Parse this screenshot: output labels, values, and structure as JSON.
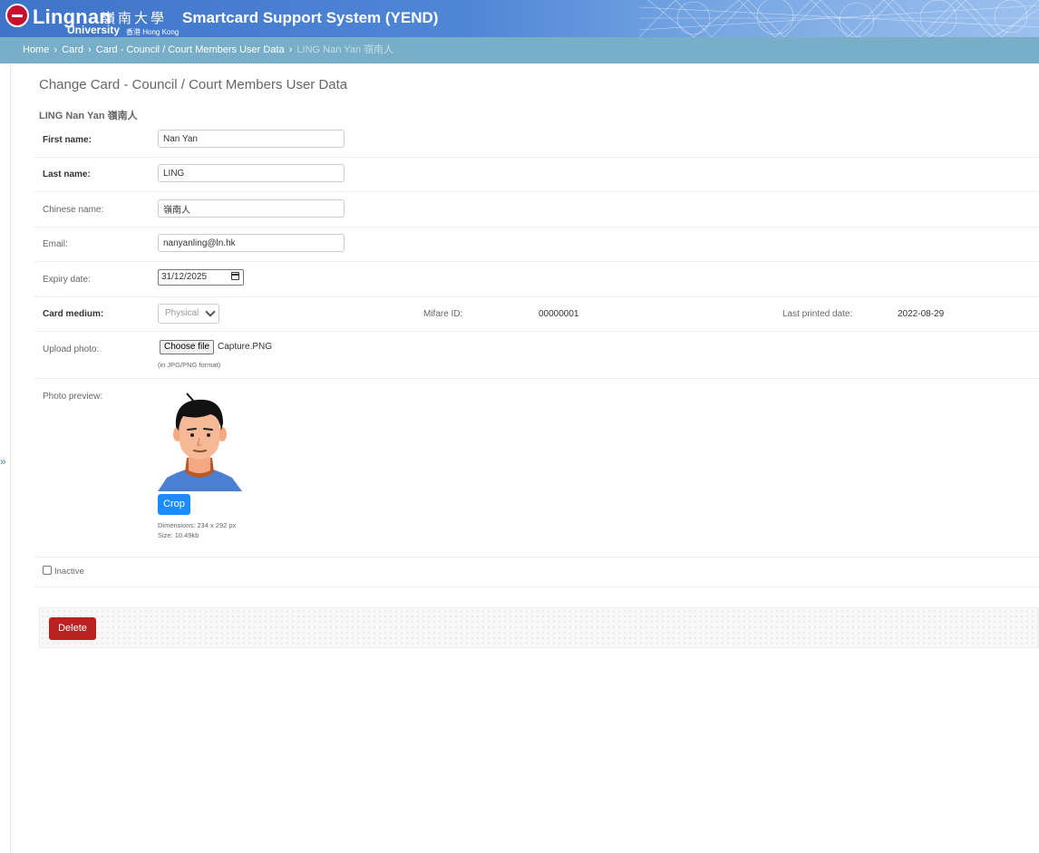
{
  "header": {
    "logo_main": "Lingnan",
    "logo_cn": "嶺南大學",
    "logo_sub": "University",
    "logo_sub2": "香港 Hong Kong",
    "site_title": "Smartcard Support System (YEND)"
  },
  "breadcrumb": {
    "items": [
      "Home",
      "Card",
      "Card - Council / Court Members User Data"
    ],
    "separator": "›",
    "current": "LING Nan Yan 嶺南人"
  },
  "sidebar": {
    "toggle": "»"
  },
  "content": {
    "title": "Change Card - Council / Court Members User Data",
    "record_name": "LING Nan Yan 嶺南人"
  },
  "form": {
    "first_name": {
      "label": "First name:",
      "value": "Nan Yan"
    },
    "last_name": {
      "label": "Last name:",
      "value": "LING"
    },
    "chinese_name": {
      "label": "Chinese name:",
      "value": "嶺南人"
    },
    "email": {
      "label": "Email:",
      "value": "nanyanling@ln.hk"
    },
    "expiry_date": {
      "label": "Expiry date:",
      "value": "31/12/2025"
    },
    "card_medium": {
      "label": "Card medium:",
      "value": "Physical"
    },
    "mifare_id": {
      "label": "Mifare ID:",
      "value": "00000001"
    },
    "last_printed": {
      "label": "Last printed date:",
      "value": "2022-08-29"
    },
    "upload_photo": {
      "label": "Upload photo:",
      "button": "Choose file",
      "file_name": "Capture.PNG",
      "help": "(in JPG/PNG format)"
    },
    "photo_preview": {
      "label": "Photo preview:",
      "crop_button": "Crop",
      "dimensions": "Dimensions: 234 x 292 px",
      "size": "Size: 10.49kb"
    },
    "inactive": {
      "label": "Inactive",
      "checked": false
    }
  },
  "actions": {
    "delete": "Delete"
  },
  "colors": {
    "header": "#417690",
    "breadcrumb_bg": "#79aec8",
    "delete": "#ba2121",
    "crop": "#1a8cff"
  }
}
